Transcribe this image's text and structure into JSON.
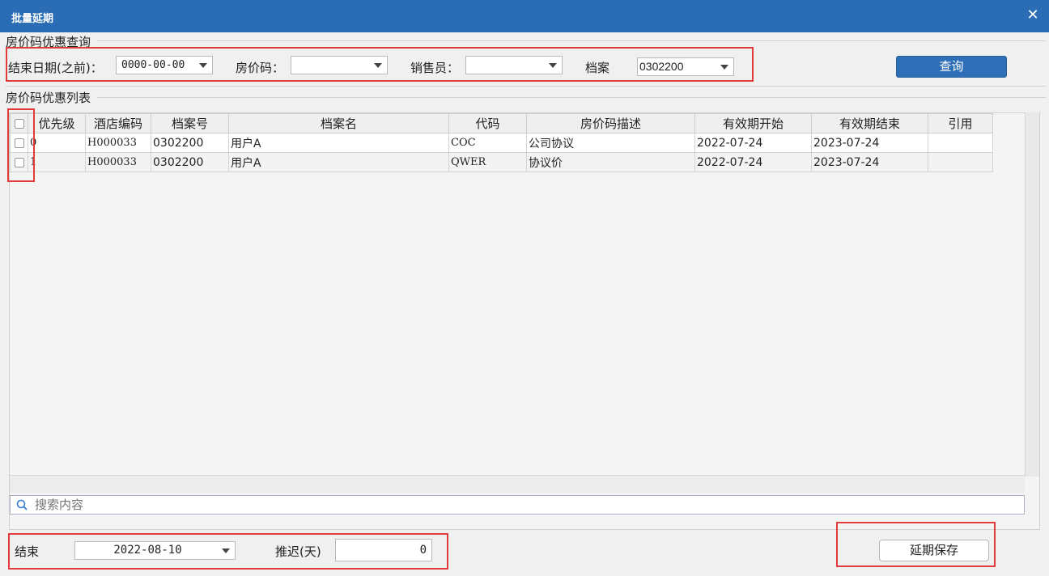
{
  "window": {
    "title": "批量延期",
    "close_glyph": "✕"
  },
  "query": {
    "legend": "房价码优惠查询",
    "end_date_label": "结束日期(之前)：",
    "end_date_value": "0000-00-00",
    "rate_code_label": "房价码：",
    "rate_code_value": "",
    "salesperson_label": "销售员：",
    "salesperson_value": "",
    "archive_label": "档案",
    "archive_value": "0302200",
    "search_button": "查询"
  },
  "list": {
    "legend": "房价码优惠列表",
    "columns": [
      "优先级",
      "酒店编码",
      "档案号",
      "档案名",
      "代码",
      "房价码描述",
      "有效期开始",
      "有效期结束",
      "引用"
    ],
    "rows": [
      [
        "0",
        "H000033",
        "0302200",
        "用户A",
        "COC",
        "公司协议",
        "2022-07-24",
        "2023-07-24",
        ""
      ],
      [
        "1",
        "H000033",
        "0302200",
        "用户A",
        "QWER",
        "协议价",
        "2022-07-24",
        "2023-07-24",
        ""
      ]
    ],
    "search_placeholder": "搜索内容"
  },
  "footer": {
    "end_label": "结束",
    "end_value": "2022-08-10",
    "delay_label": "推迟(天)",
    "delay_value": "0",
    "save_button": "延期保存"
  },
  "colors": {
    "titlebar": "#2b6db4",
    "primary_button": "#2f6fb7",
    "highlight_box": "#e23b3b"
  },
  "icons": [
    "close-icon",
    "dropdown-arrow-icon",
    "search-icon",
    "checkbox-icon"
  ]
}
